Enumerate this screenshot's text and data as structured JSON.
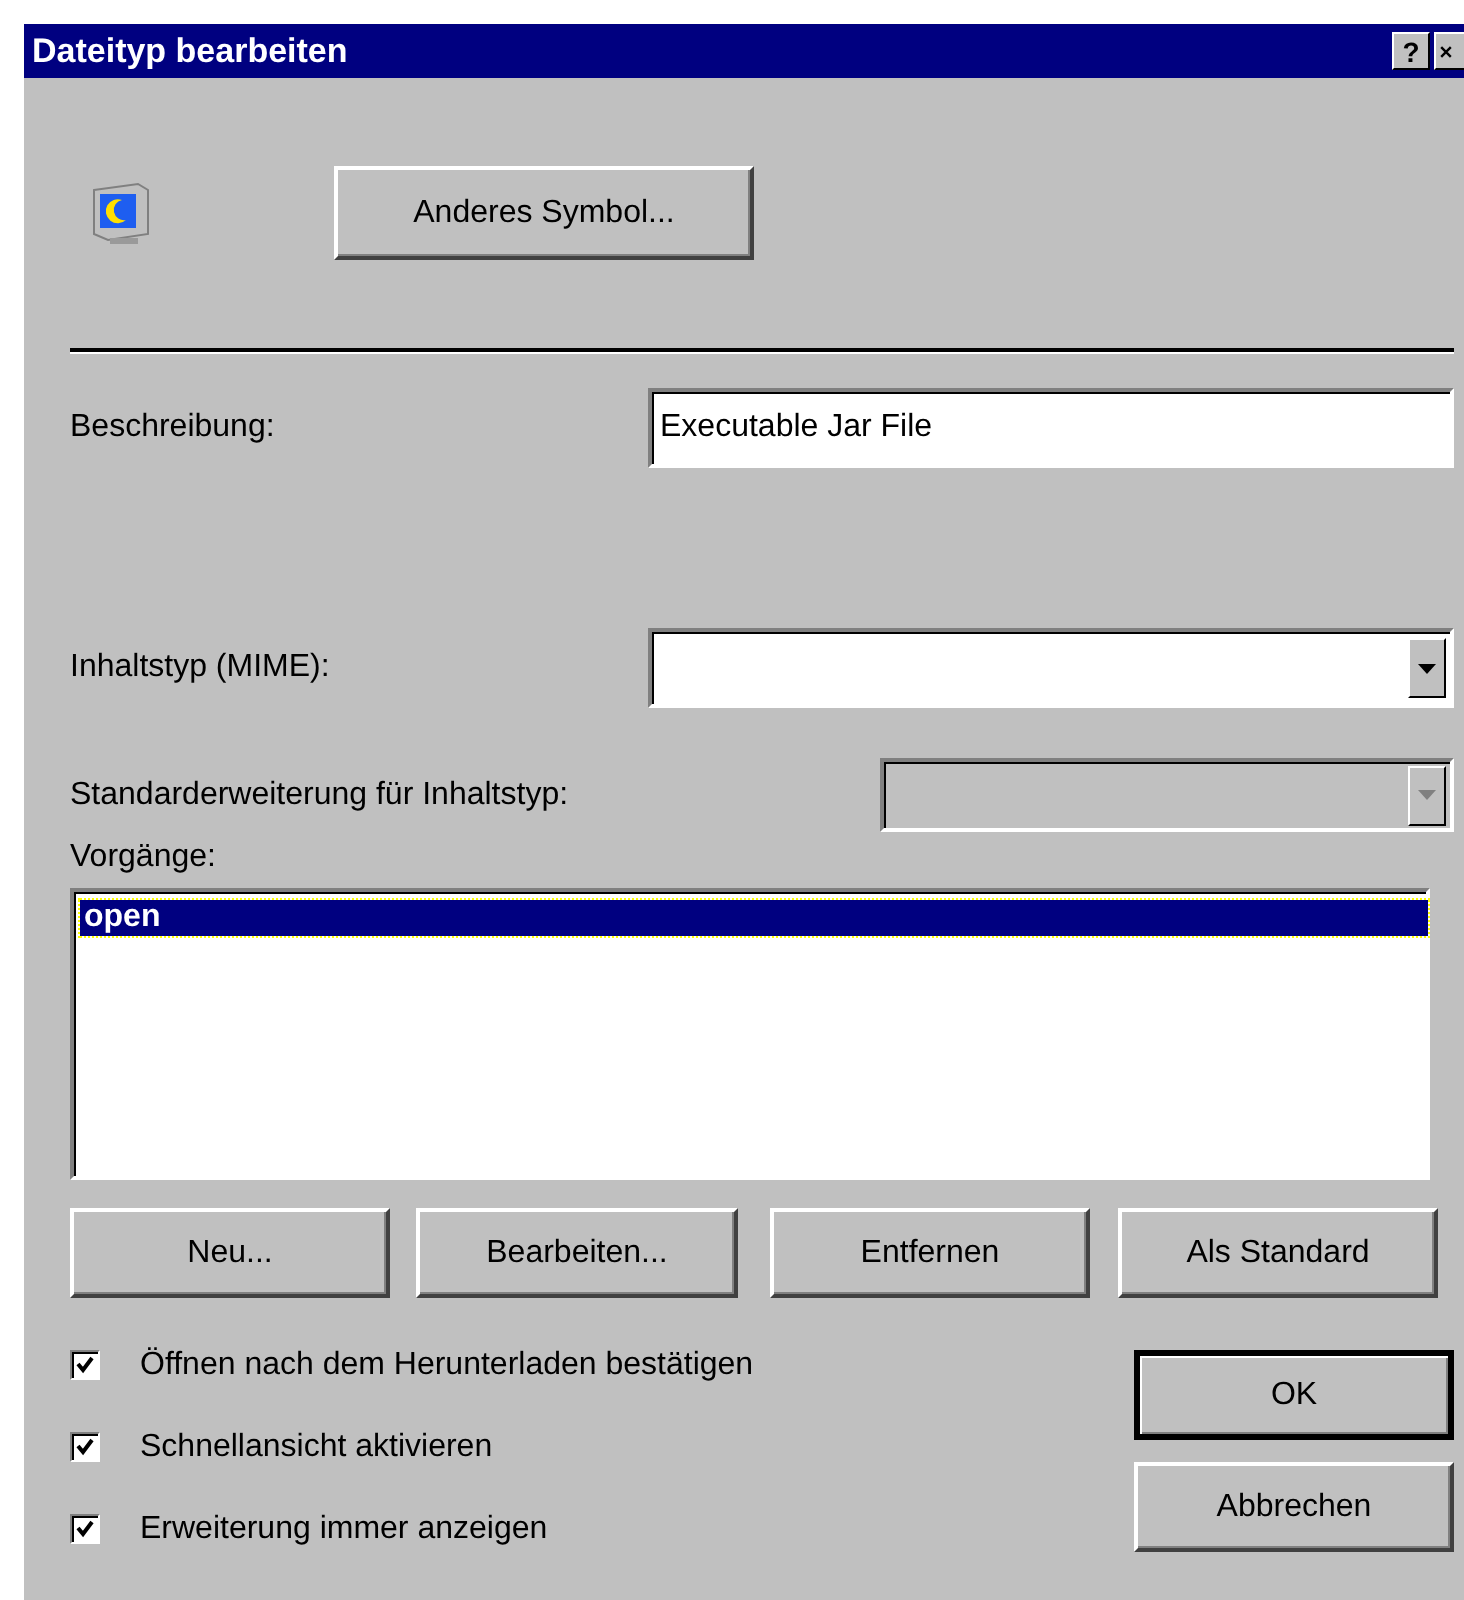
{
  "window": {
    "title": "Dateityp bearbeiten",
    "help_button": "?"
  },
  "change_icon_button": "Anderes Symbol...",
  "description": {
    "label": "Beschreibung:",
    "value": "Executable Jar File"
  },
  "content_type": {
    "label": "Inhaltstyp (MIME):",
    "disabled": false
  },
  "default_extension": {
    "label": "Standarderweiterung für Inhaltstyp:",
    "disabled": true
  },
  "actions": {
    "label": "Vorgänge:",
    "items": [
      {
        "label": "open",
        "selected": true
      }
    ]
  },
  "action_buttons": [
    "Neu...",
    "Bearbeiten...",
    "Entfernen",
    "Als Standard"
  ],
  "options": [
    {
      "label": "Öffnen nach dem Herunterladen bestätigen",
      "checked": true
    },
    {
      "label": "Schnellansicht aktivieren",
      "checked": true
    },
    {
      "label": "Erweiterung immer anzeigen",
      "checked": true
    }
  ],
  "buttons": [
    {
      "label": "OK",
      "default": true
    },
    {
      "label": "Abbrechen",
      "default": false
    }
  ]
}
